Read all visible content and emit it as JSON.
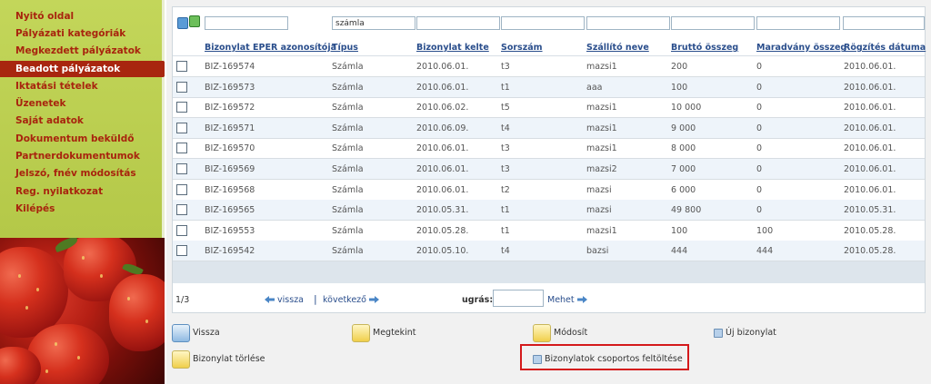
{
  "sidebar": {
    "items": [
      {
        "label": "Nyitó oldal",
        "active": false
      },
      {
        "label": "Pályázati kategóriák",
        "active": false
      },
      {
        "label": "Megkezdett pályázatok",
        "active": false
      },
      {
        "label": "Beadott pályázatok",
        "active": true
      },
      {
        "label": "Iktatási tételek",
        "active": false
      },
      {
        "label": "Üzenetek",
        "active": false
      },
      {
        "label": "Saját adatok",
        "active": false
      },
      {
        "label": "Dokumentum beküldő",
        "active": false
      },
      {
        "label": "Partnerdokumentumok",
        "active": false
      },
      {
        "label": "Jelszó, fnév módosítás",
        "active": false
      },
      {
        "label": "Reg. nyilatkozat",
        "active": false
      },
      {
        "label": "Kilépés",
        "active": false
      }
    ]
  },
  "filters": {
    "icons": [
      "refresh-icon",
      "excel-export-icon"
    ],
    "values": [
      "",
      "számla",
      "",
      "",
      "",
      "",
      "",
      ""
    ]
  },
  "table": {
    "columns": [
      "Bizonylat EPER azonosítója",
      "Típus",
      "Bizonylat kelte",
      "Sorszám",
      "Szállító neve",
      "Bruttó összeg",
      "Maradvány összeg",
      "Rögzítés dátuma"
    ],
    "rows": [
      [
        "BIZ-169574",
        "Számla",
        "2010.06.01.",
        "t3",
        "mazsi1",
        "200",
        "0",
        "2010.06.01."
      ],
      [
        "BIZ-169573",
        "Számla",
        "2010.06.01.",
        "t1",
        "aaa",
        "100",
        "0",
        "2010.06.01."
      ],
      [
        "BIZ-169572",
        "Számla",
        "2010.06.02.",
        "t5",
        "mazsi1",
        "10 000",
        "0",
        "2010.06.01."
      ],
      [
        "BIZ-169571",
        "Számla",
        "2010.06.09.",
        "t4",
        "mazsi1",
        "9 000",
        "0",
        "2010.06.01."
      ],
      [
        "BIZ-169570",
        "Számla",
        "2010.06.01.",
        "t3",
        "mazsi1",
        "8 000",
        "0",
        "2010.06.01."
      ],
      [
        "BIZ-169569",
        "Számla",
        "2010.06.01.",
        "t3",
        "mazsi2",
        "7 000",
        "0",
        "2010.06.01."
      ],
      [
        "BIZ-169568",
        "Számla",
        "2010.06.01.",
        "t2",
        "mazsi",
        "6 000",
        "0",
        "2010.06.01."
      ],
      [
        "BIZ-169565",
        "Számla",
        "2010.05.31.",
        "t1",
        "mazsi",
        "49 800",
        "0",
        "2010.05.31."
      ],
      [
        "BIZ-169553",
        "Számla",
        "2010.05.28.",
        "t1",
        "mazsi1",
        "100",
        "100",
        "2010.05.28."
      ],
      [
        "BIZ-169542",
        "Számla",
        "2010.05.10.",
        "t4",
        "bazsi",
        "444",
        "444",
        "2010.05.28."
      ]
    ]
  },
  "pager": {
    "page_info": "1/3",
    "prev_label": "vissza",
    "separator": "|",
    "next_label": "következő",
    "jump_label": "ugrás:",
    "jump_value": "",
    "go_label": "Mehet"
  },
  "actions": {
    "back": "Vissza",
    "view": "Megtekint",
    "edit": "Módosít",
    "new_doc": "Új bizonylat",
    "delete": "Bizonylat törlése",
    "bulk_upload": "Bizonylatok csoportos feltöltése"
  },
  "colors": {
    "sidebar_bg": "#b9cc4c",
    "menu_text": "#a8240e",
    "menu_active_bg": "#a8260f",
    "link": "#2a4e8c",
    "row_alt": "#eef4fa",
    "highlight": "#d4191b"
  }
}
